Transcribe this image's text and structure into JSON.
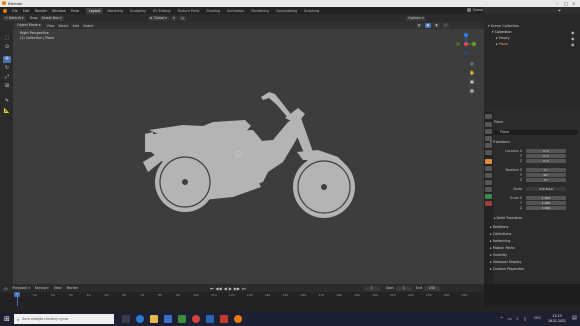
{
  "app": {
    "title": "Blender"
  },
  "menu": {
    "items": [
      "File",
      "Edit",
      "Render",
      "Window",
      "Help"
    ],
    "workspaces": [
      "Layout",
      "Modeling",
      "Sculpting",
      "UV Editing",
      "Texture Paint",
      "Shading",
      "Animation",
      "Rendering",
      "Compositing",
      "Scripting"
    ],
    "active_workspace": "Layout",
    "scene": "Scene",
    "view_layer": "View Layer"
  },
  "header": {
    "mode": "Object Mode",
    "view": "View",
    "select": "Select",
    "add": "Add",
    "object": "Object",
    "orientation": "Default",
    "drag": "Drag",
    "drag_value": "Select Box",
    "transform_pivot": "Global",
    "options": "Options"
  },
  "viewport": {
    "perspective": "Right Perspective",
    "collection_info": "(1) Collection | Plane"
  },
  "outliner": {
    "root": "Scene Collection",
    "items": [
      {
        "label": "Collection"
      },
      {
        "label": "Empty"
      },
      {
        "label": "Plane"
      }
    ]
  },
  "properties": {
    "object_name": "Plane",
    "object_field": "Plane",
    "transform_title": "Transform",
    "location_label": "Location X",
    "location": [
      "0 m",
      "0 m",
      "0 m"
    ],
    "rotation_label": "Rotation X",
    "rotation": [
      "0°",
      "90°",
      "0°"
    ],
    "mode_label": "Mode",
    "mode_value": "XYZ Euler",
    "scale_label": "Scale X",
    "scale": [
      "1.000",
      "1.000",
      "1.000"
    ],
    "axis_y": "Y",
    "axis_z": "Z",
    "delta": "Delta Transform",
    "sections": [
      "Relations",
      "Collections",
      "Instancing",
      "Motion Paths",
      "Visibility",
      "Viewport Display",
      "Custom Properties"
    ]
  },
  "timeline": {
    "playback": "Playback",
    "keying": "Keying",
    "view": "View",
    "marker": "Marker",
    "current_frame": "1",
    "start_label": "Start",
    "start": "1",
    "end_label": "End",
    "end": "250",
    "ticks": [
      "0",
      "10",
      "20",
      "30",
      "40",
      "50",
      "60",
      "70",
      "80",
      "90",
      "100",
      "110",
      "120",
      "130",
      "140",
      "150",
      "160",
      "170",
      "180",
      "190",
      "200",
      "210",
      "220",
      "230",
      "240",
      "250"
    ]
  },
  "taskbar": {
    "search_placeholder": "Sem zadejte hledaný výraz",
    "language": "CES",
    "time": "12:23",
    "date": "26.01.2021"
  },
  "colors": {
    "accent": "#4772b3",
    "viewport_bg": "#3d3d3d",
    "silhouette": "#b4b4b4",
    "playhead": "#4772b3"
  }
}
